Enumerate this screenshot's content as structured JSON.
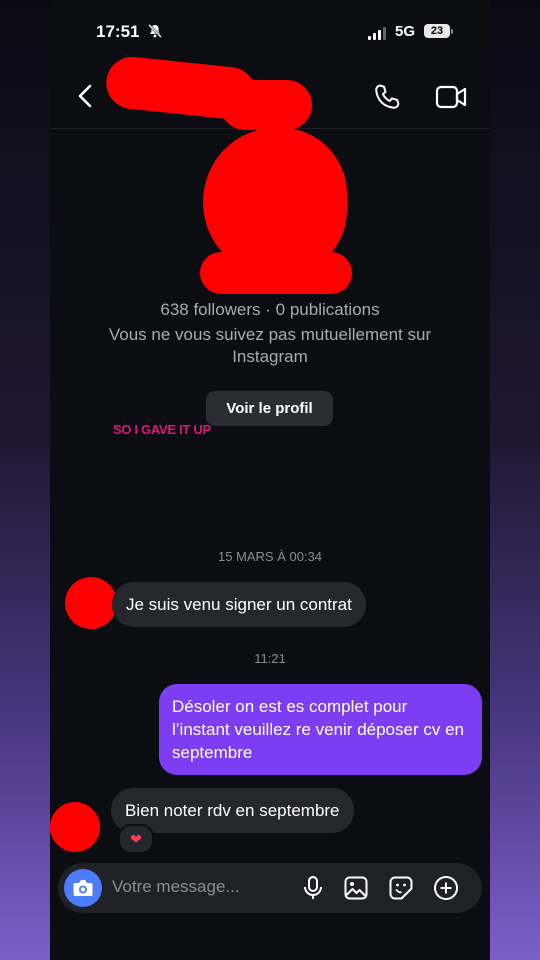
{
  "status_bar": {
    "time": "17:51",
    "network": "5G",
    "battery": "23"
  },
  "profile": {
    "followers_line": "638 followers · 0 publications",
    "mutual_line": "Vous ne vous suivez pas mutuellement sur Instagram",
    "view_profile_label": "Voir le profil"
  },
  "overlay_caption": "SO I GAVE IT UP",
  "conversation": {
    "timestamp_1": "15 MARS À 00:34",
    "msg_1": "Je suis venu signer un contrat",
    "timestamp_2": "11:21",
    "msg_2": "Désoler on est es complet pour l’instant veuillez re venir déposer cv en septembre",
    "msg_3": "Bien noter rdv en septembre",
    "reaction": "❤"
  },
  "composer": {
    "placeholder": "Votre message..."
  },
  "colors": {
    "accent_purple": "#7d3df2",
    "camera_blue": "#4d7cff",
    "redaction_red": "#ff0000",
    "caption_pink": "#e0157a"
  }
}
